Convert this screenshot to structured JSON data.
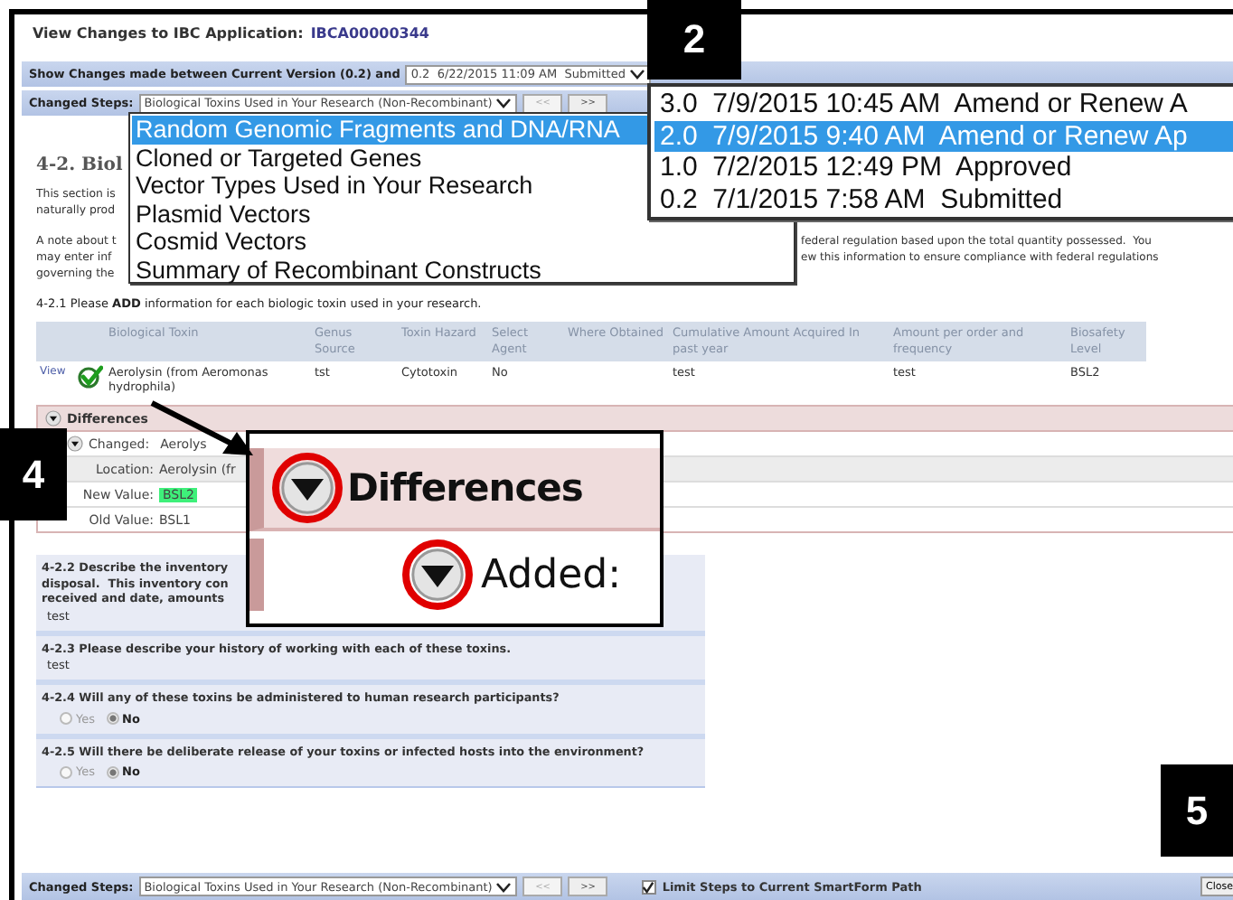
{
  "title": {
    "label": "View Changes to IBC Application:",
    "app_id": "IBCA00000344"
  },
  "compare_bar": {
    "label": "Show Changes made between Current Version (0.2) and",
    "version_select": "0.2  6/22/2015 11:09 AM  Submitted"
  },
  "steps_bar": {
    "label": "Changed Steps:",
    "step_select": "Biological Toxins Used in Your Research (Non-Recombinant)",
    "prev_button": "<<",
    "next_button": ">>"
  },
  "section": {
    "heading": "4-2. Biol",
    "intro": [
      "This section is",
      "naturally prod"
    ],
    "note_left": [
      "A note about t",
      "may enter inf",
      "governing the"
    ],
    "note_right": [
      "federal regulation based upon the total quantity possessed.  You",
      "ew this information to ensure compliance with federal regulations"
    ]
  },
  "table": {
    "intro": "4-2.1 Please **ADD** information for each biologic toxin used in your research.",
    "columns": [
      "Biological Toxin",
      "Genus Source",
      "Toxin Hazard",
      "Select Agent",
      "Where Obtained",
      "Cumulative Amount Acquired In past year",
      "Amount per order and frequency",
      "Biosafety Level"
    ],
    "rows": [
      {
        "link": "View",
        "cells": [
          "Aerolysin (from Aeromonas hydrophila)",
          "tst",
          "Cytotoxin",
          "No",
          null,
          "test",
          "test",
          "BSL2"
        ]
      }
    ]
  },
  "differences": {
    "title": "Differences",
    "expanded": true,
    "change": {
      "label": "Changed:",
      "value": "Aerolys",
      "expanded": true
    },
    "fields": [
      {
        "label": "Location:",
        "value": "Aerolysin (fr",
        "kind": "plain"
      },
      {
        "label": "New Value:",
        "value": "BSL2",
        "kind": "new"
      },
      {
        "label": "Old Value:",
        "value": "BSL1",
        "kind": "old"
      }
    ]
  },
  "questions": [
    {
      "kind": "text",
      "prompt": [
        "4-2.2 Describe the inventory",
        "disposal.  This inventory con",
        "received and date, amounts"
      ],
      "answer": "test"
    },
    {
      "kind": "text",
      "prompt": [
        "4-2.3 Please describe your history of working with each of these toxins."
      ],
      "answer": "test"
    },
    {
      "kind": "radio",
      "prompt": [
        "4-2.4 Will any of these toxins be administered to human research participants?"
      ],
      "options": [
        {
          "label": "Yes",
          "selected": false
        },
        {
          "label": "No",
          "selected": true
        }
      ]
    },
    {
      "kind": "radio",
      "prompt": [
        "4-2.5 Will there be deliberate release of your toxins or infected hosts into the environment?"
      ],
      "options": [
        {
          "label": "Yes",
          "selected": false
        },
        {
          "label": "No",
          "selected": true
        }
      ]
    }
  ],
  "bottom_bar": {
    "label": "Changed Steps:",
    "step_select": "Biological Toxins Used in Your Research (Non-Recombinant)",
    "prev_button": "<<",
    "next_button": ">>",
    "limit_checkbox": {
      "label": "Limit Steps to Current SmartForm Path",
      "checked": true
    },
    "close_button": "Close"
  },
  "step_dropdown": {
    "items": [
      {
        "label": "Random Genomic Fragments and DNA/RNA",
        "selected": true
      },
      {
        "label": "Cloned or Targeted Genes",
        "selected": false
      },
      {
        "label": "Vector Types Used in Your Research",
        "selected": false
      },
      {
        "label": "Plasmid Vectors",
        "selected": false
      },
      {
        "label": "Cosmid Vectors",
        "selected": false
      },
      {
        "label": "Summary of Recombinant Constructs",
        "selected": false
      }
    ]
  },
  "version_dropdown": {
    "items": [
      {
        "label": "3.0  7/9/2015 10:45 AM  Amend or Renew A",
        "selected": false
      },
      {
        "label": "2.0  7/9/2015 9:40 AM  Amend or Renew Ap",
        "selected": true
      },
      {
        "label": "1.0  7/2/2015 12:49 PM  Approved",
        "selected": false
      },
      {
        "label": "0.2  7/1/2015 7:58 AM  Submitted",
        "selected": false
      }
    ]
  },
  "inset": {
    "title": "Differences",
    "added_label": "Added:",
    "expanded": true
  },
  "callouts": [
    {
      "number": "2"
    },
    {
      "number": "4"
    },
    {
      "number": "5"
    }
  ]
}
